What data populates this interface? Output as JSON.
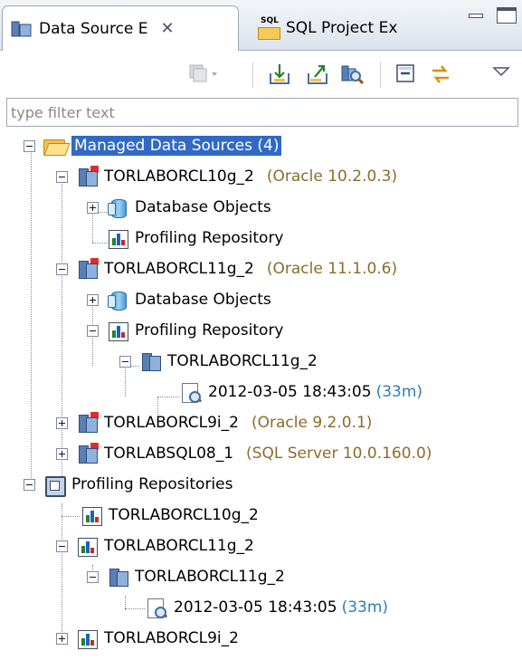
{
  "tabs": [
    {
      "label": "Data Source E",
      "active": true,
      "icon": "datasource-explorer-icon"
    },
    {
      "label": "SQL Project Ex",
      "active": false,
      "icon": "sql-project-icon",
      "badge": "SQL"
    }
  ],
  "filter": {
    "placeholder": "type filter text"
  },
  "tree": [
    {
      "label": "Managed Data Sources (4)",
      "icon": "folder-open-icon",
      "selected": true
    },
    {
      "label": "TORLABORCL10g_2",
      "extra": "(Oracle 10.2.0.3)",
      "icon": "datasource-icon"
    },
    {
      "label": "Database Objects",
      "icon": "database-objects-icon"
    },
    {
      "label": "Profiling Repository",
      "icon": "profiling-repository-icon"
    },
    {
      "label": "TORLABORCL11g_2",
      "extra": "(Oracle 11.1.0.6)",
      "icon": "datasource-icon"
    },
    {
      "label": "Database Objects",
      "icon": "database-objects-icon"
    },
    {
      "label": "Profiling Repository",
      "icon": "profiling-repository-icon"
    },
    {
      "label": "TORLABORCL11g_2",
      "icon": "server-icon"
    },
    {
      "label": "2012-03-05 18:43:05",
      "duration": "(33m)",
      "icon": "profile-report-icon"
    },
    {
      "label": "TORLABORCL9i_2",
      "extra": "(Oracle 9.2.0.1)",
      "icon": "datasource-icon"
    },
    {
      "label": "TORLABSQL08_1",
      "extra": "(SQL Server 10.0.160.0)",
      "icon": "datasource-icon"
    },
    {
      "label": "Profiling Repositories",
      "icon": "repositories-icon"
    },
    {
      "label": "TORLABORCL10g_2",
      "icon": "profiling-repository-icon"
    },
    {
      "label": "TORLABORCL11g_2",
      "icon": "profiling-repository-icon"
    },
    {
      "label": "TORLABORCL11g_2",
      "icon": "server-icon"
    },
    {
      "label": "2012-03-05 18:43:05",
      "duration": "(33m)",
      "icon": "profile-report-icon"
    },
    {
      "label": "TORLABORCL9i_2",
      "icon": "profiling-repository-icon"
    }
  ],
  "colors": {
    "selection": "#3169c6",
    "version_text": "#8b6c2a",
    "duration_text": "#2f7db8"
  }
}
